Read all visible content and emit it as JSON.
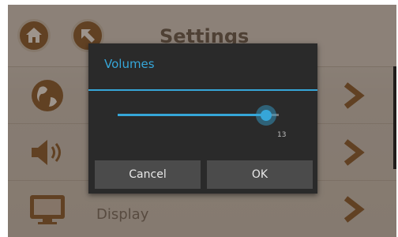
{
  "screen": {
    "title": "Settings",
    "rows": [
      {
        "icon": "globe-icon",
        "label": ""
      },
      {
        "icon": "speaker-icon",
        "label": ""
      },
      {
        "icon": "monitor-icon",
        "label": "Display"
      }
    ]
  },
  "dialog": {
    "title": "Volumes",
    "slider": {
      "value": "13",
      "fraction": 0.92
    },
    "cancel_label": "Cancel",
    "ok_label": "OK"
  },
  "colors": {
    "accent": "#36a6d8",
    "dialog_bg": "#2a2a2a",
    "button_bg": "#4b4b4b"
  }
}
